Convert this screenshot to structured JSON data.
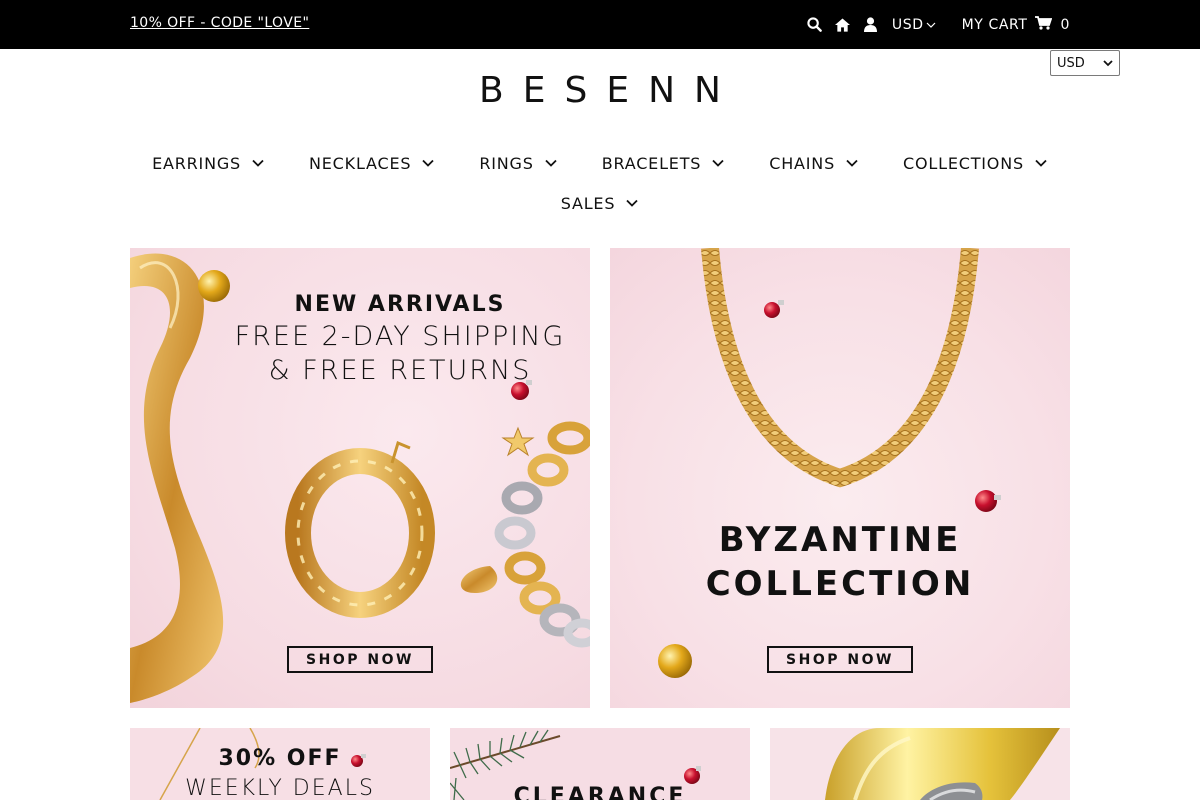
{
  "topbar": {
    "promo": "10% OFF - CODE \"LOVE\"",
    "currency": "USD",
    "cart_label": "MY CART",
    "cart_count": "0"
  },
  "currency_select": {
    "value": "USD"
  },
  "logo": "BESENN",
  "nav": {
    "items": [
      {
        "label": "EARRINGS"
      },
      {
        "label": "NECKLACES"
      },
      {
        "label": "RINGS"
      },
      {
        "label": "BRACELETS"
      },
      {
        "label": "CHAINS"
      },
      {
        "label": "COLLECTIONS"
      },
      {
        "label": "SALES"
      }
    ]
  },
  "banners": {
    "new_arrivals": {
      "line1": "NEW ARRIVALS",
      "line2": "FREE 2-DAY SHIPPING",
      "line3": "& FREE RETURNS",
      "button": "SHOP NOW"
    },
    "byzantine": {
      "line1": "BYZANTINE",
      "line2": "COLLECTION",
      "button": "SHOP NOW"
    },
    "weekly_deals": {
      "line1": "30% OFF",
      "line2": "WEEKLY DEALS"
    },
    "clearance": {
      "line1": "CLEARANCE"
    }
  },
  "icons": [
    "search-icon",
    "home-icon",
    "user-icon",
    "chevron-down-icon",
    "cart-icon"
  ],
  "colors": {
    "topbar": "#000000",
    "banner_pink": "#f8e1e6",
    "gold": "#d9a441",
    "ornament_red": "#c8102e"
  }
}
